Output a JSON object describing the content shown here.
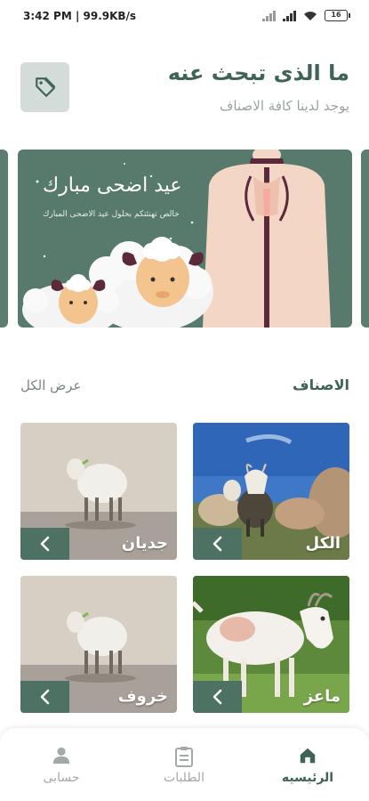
{
  "status_bar": {
    "time_speed": "3:42 PM | 99.9KB/s",
    "battery": "16"
  },
  "header": {
    "title": "ما الذى تبحث عنه",
    "subtitle": "يوجد لدينا كافة الاصناف"
  },
  "banner": {
    "title": "عيد اضحى مبارك",
    "subtitle": "خالص تهنئتكم بحلول عيد الاضحى المبارك"
  },
  "categories_section": {
    "title": "الاصناف",
    "view_all": "عرض الكل"
  },
  "categories": [
    {
      "label": "الكل"
    },
    {
      "label": "جديان"
    },
    {
      "label": "ماعز"
    },
    {
      "label": "خروف"
    }
  ],
  "bottom_nav": {
    "home": "الرئيسيه",
    "orders": "الطلبات",
    "account": "حسابى"
  },
  "colors": {
    "primary": "#3f6457",
    "banner": "#587a6d",
    "accent_light": "#d3dcd9"
  }
}
